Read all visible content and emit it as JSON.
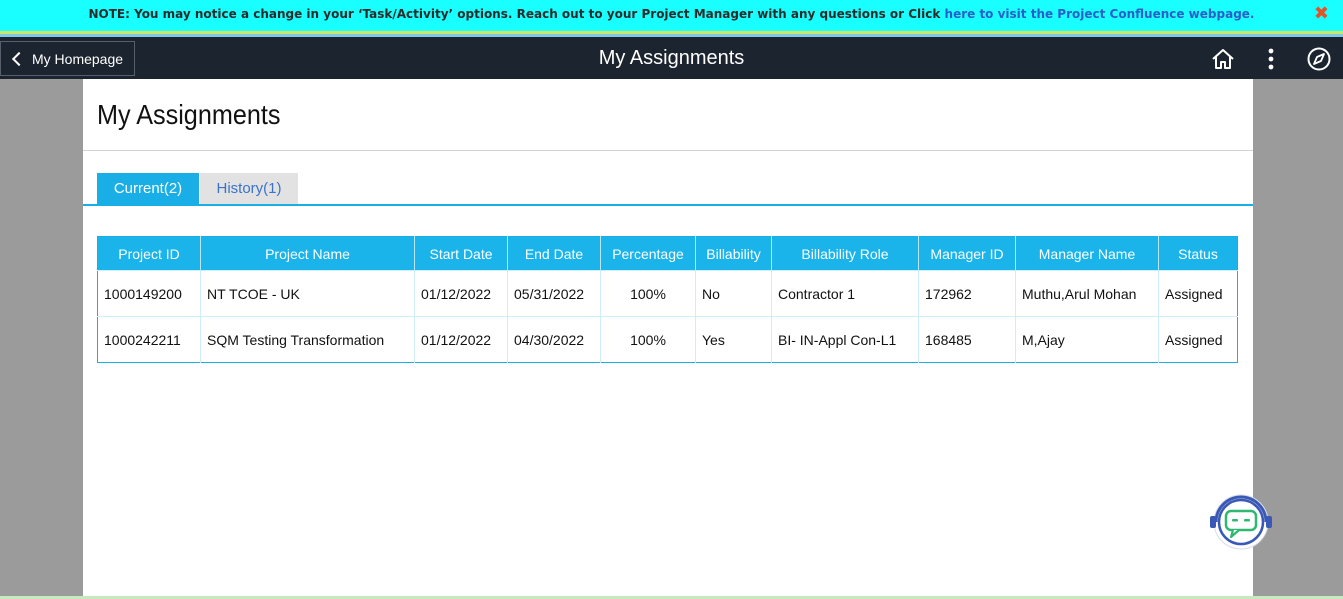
{
  "notice": {
    "text": "NOTE: You may notice a change in your ‘Task/Activity’ options. Reach out to your Project Manager with any questions or Click ",
    "link": "here to visit the Project Confluence webpage.",
    "close": "✖"
  },
  "header": {
    "back_label": "My Homepage",
    "title": "My Assignments",
    "icons": [
      "home-icon",
      "more-vertical-icon",
      "compass-icon"
    ]
  },
  "page": {
    "title": "My Assignments"
  },
  "tabs": [
    {
      "label": "Current(2)",
      "active": true
    },
    {
      "label": "History(1)",
      "active": false
    }
  ],
  "table": {
    "columns": [
      "Project ID",
      "Project Name",
      "Start Date",
      "End Date",
      "Percentage",
      "Billability",
      "Billability Role",
      "Manager ID",
      "Manager Name",
      "Status"
    ],
    "rows": [
      [
        "1000149200",
        "NT TCOE  - UK",
        "01/12/2022",
        "05/31/2022",
        "100%",
        "No",
        "Contractor 1",
        "172962",
        "Muthu,Arul Mohan",
        "Assigned"
      ],
      [
        "1000242211",
        "SQM Testing Transformation",
        "01/12/2022",
        "04/30/2022",
        "100%",
        "Yes",
        "BI- IN-Appl Con-L1",
        "168485",
        "M,Ajay",
        "Assigned"
      ]
    ]
  },
  "colors": {
    "accent": "#1ab4ea",
    "header_bg": "#1c2430",
    "notice_bg": "#19ffff",
    "link": "#2a5fc9"
  }
}
